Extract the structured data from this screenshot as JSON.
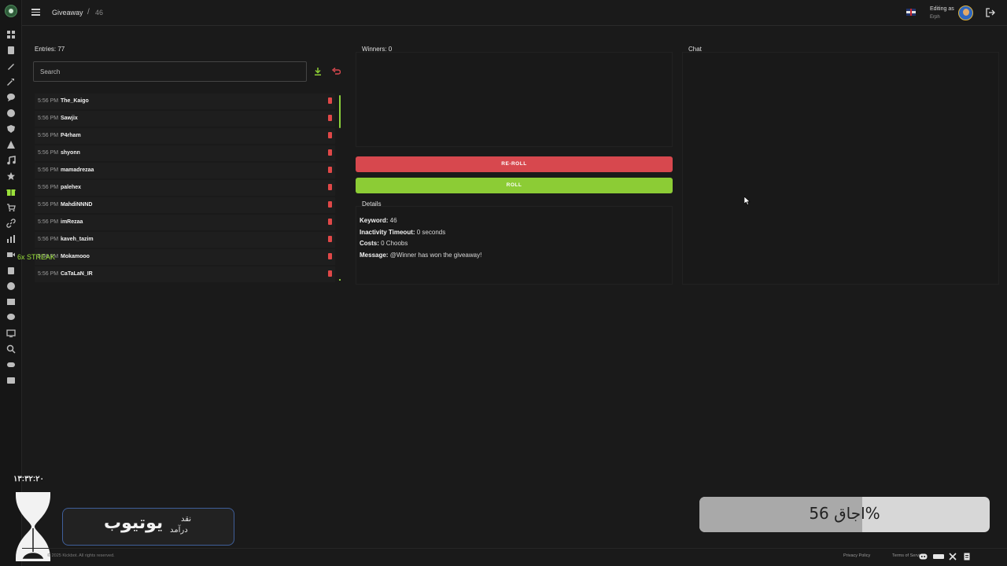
{
  "breadcrumb": {
    "main": "Giveaway",
    "sep": "/",
    "sub": "46"
  },
  "user": {
    "editing_label": "Editing as",
    "name": "Erph"
  },
  "entries": {
    "title": "Entries: 77",
    "search_placeholder": "Search",
    "items": [
      {
        "time": "5:56 PM",
        "name": "The_Kaigo"
      },
      {
        "time": "5:56 PM",
        "name": "Sawjix"
      },
      {
        "time": "5:56 PM",
        "name": "P4rham"
      },
      {
        "time": "5:56 PM",
        "name": "shyonn"
      },
      {
        "time": "5:56 PM",
        "name": "mamadrezaa"
      },
      {
        "time": "5:56 PM",
        "name": "palehex"
      },
      {
        "time": "5:56 PM",
        "name": "MahdiNNND"
      },
      {
        "time": "5:56 PM",
        "name": "imRezaa"
      },
      {
        "time": "5:56 PM",
        "name": "kaveh_tazim"
      },
      {
        "time": "5:56 PM",
        "name": "Mokamooo"
      },
      {
        "time": "5:56 PM",
        "name": "CaTaLaN_IR"
      }
    ]
  },
  "streak": "6x STREAK",
  "winners": {
    "title": "Winners: 0"
  },
  "buttons": {
    "reroll": "RE-ROLL",
    "roll": "ROLL"
  },
  "details": {
    "title": "Details",
    "keyword_label": "Keyword:",
    "keyword_value": " 46",
    "timeout_label": "Inactivity Timeout:",
    "timeout_value": " 0 seconds",
    "costs_label": "Costs:",
    "costs_value": " 0 Choobs",
    "message_label": "Message:",
    "message_value": " @Winner has won the giveaway!"
  },
  "chat": {
    "title": "Chat"
  },
  "overlay": {
    "timer": "۱۳:۳۲:۲۰",
    "yt_big": "یوتیوب",
    "yt_small1": "نقد",
    "yt_small2": "درآمد",
    "progress_text": "اجاق 56%",
    "progress_value": 0.56
  },
  "footer": {
    "copyright": "© 2025 Kickbot. All rights reserved.",
    "privacy": "Privacy Policy",
    "terms": "Terms of Service"
  },
  "colors": {
    "accent": "#8ccc35",
    "danger": "#d7484e",
    "background": "#1a1a1a"
  }
}
